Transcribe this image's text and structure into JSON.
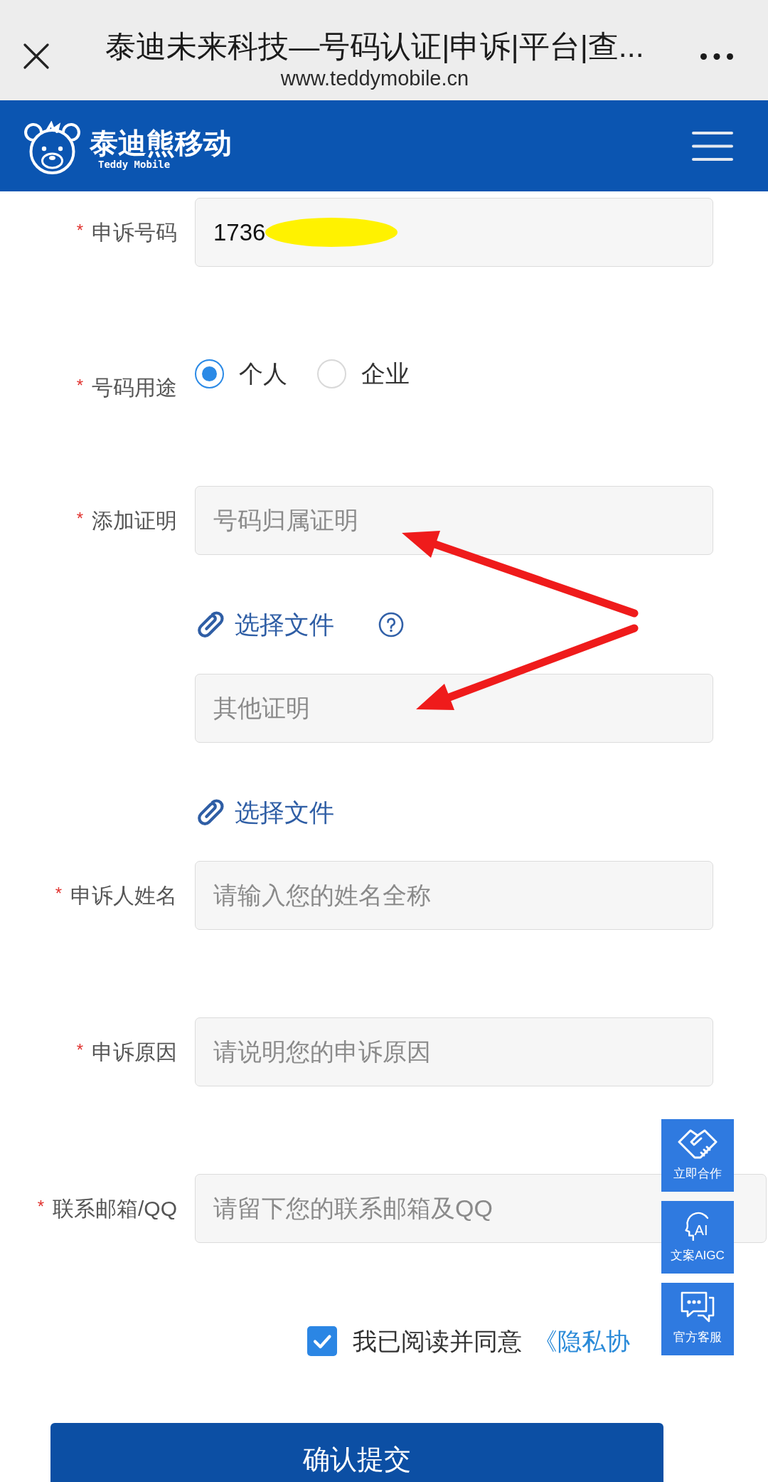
{
  "browser_bar": {
    "title": "泰迪未来科技—号码认证|申诉|平台|查...",
    "url": "www.teddymobile.cn"
  },
  "header": {
    "logo_text": "泰迪熊移动",
    "logo_tagline": "Teddy Mobile"
  },
  "form": {
    "fields": [
      {
        "kind": "text",
        "required_mark": "*",
        "label": "申诉号码",
        "value": "1736",
        "redacted": true
      },
      {
        "kind": "radio",
        "required_mark": "*",
        "label": "号码用途",
        "options": [
          {
            "label": "个人",
            "selected": true
          },
          {
            "label": "企业",
            "selected": false
          }
        ]
      },
      {
        "kind": "upload",
        "required_mark": "*",
        "label": "添加证明",
        "uploads": [
          {
            "placeholder": "号码归属证明",
            "link": "选择文件",
            "help": true
          },
          {
            "placeholder": "其他证明",
            "link": "选择文件",
            "help": false
          }
        ]
      },
      {
        "kind": "text",
        "required_mark": "*",
        "label": "申诉人姓名",
        "placeholder": "请输入您的姓名全称"
      },
      {
        "kind": "text",
        "required_mark": "*",
        "label": "申诉原因",
        "placeholder": "请说明您的申诉原因"
      },
      {
        "kind": "text",
        "required_mark": "*",
        "label": "联系邮箱/QQ",
        "placeholder": "请留下您的联系邮箱及QQ"
      }
    ]
  },
  "agreement": {
    "checked": true,
    "text": "我已阅读并同意",
    "link": "《隐私协"
  },
  "submit_button": {
    "label": "确认提交"
  },
  "floating_buttons": [
    {
      "kind": "handshake",
      "label": "立即合作"
    },
    {
      "kind": "ai",
      "icon_text": "AI",
      "label": "文案AIGC"
    },
    {
      "kind": "chat",
      "label": "官方客服"
    }
  ]
}
